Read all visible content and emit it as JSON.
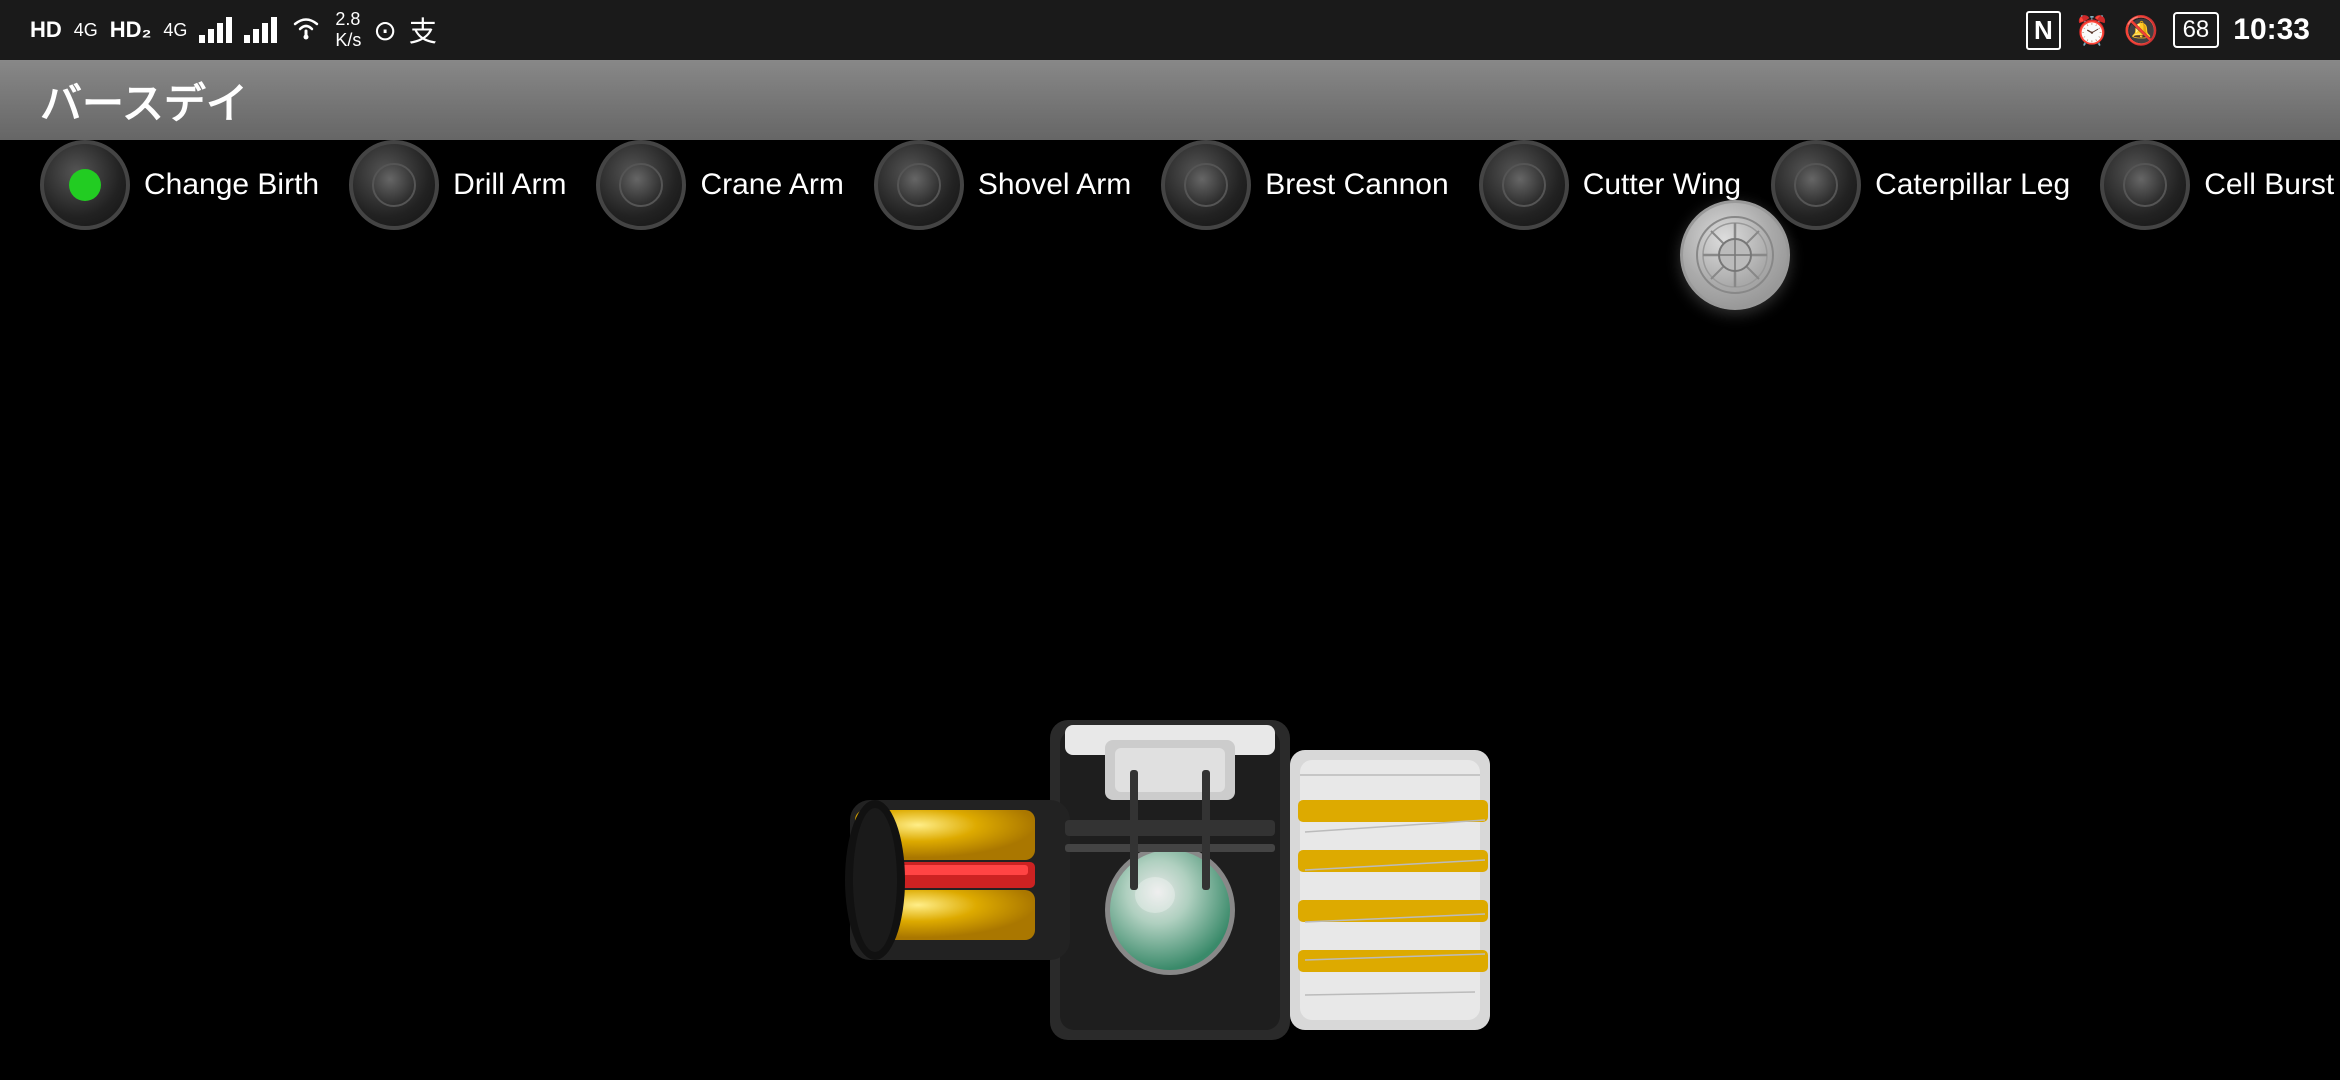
{
  "statusBar": {
    "leftItems": [
      "HD₁",
      "4G",
      "HD₂",
      "4G",
      "2.8 K/s"
    ],
    "rightItems": [
      "N",
      "⏰",
      "🔕",
      "68",
      "10:33"
    ]
  },
  "appTitle": "バースデイ",
  "buttons": [
    {
      "id": "change-birth",
      "label": "Change\nBirth",
      "active": true
    },
    {
      "id": "drill-arm",
      "label": "Drill\nArm",
      "active": false
    },
    {
      "id": "crane-arm",
      "label": "Crane\nArm",
      "active": false
    },
    {
      "id": "shovel-arm",
      "label": "Shovel\nArm",
      "active": false
    },
    {
      "id": "brest-cannon",
      "label": "Brest\nCannon",
      "active": false
    },
    {
      "id": "cutter-wing",
      "label": "Cutter\nWing",
      "active": false
    },
    {
      "id": "caterpillar-leg",
      "label": "Caterpillar\nLeg",
      "active": false
    },
    {
      "id": "cell-burst",
      "label": "Cell\nBurst",
      "active": false
    }
  ],
  "device": {
    "description": "Birth Driver device illustration"
  },
  "colors": {
    "activeDot": "#22cc22",
    "titleBarStart": "#888888",
    "titleBarEnd": "#666666",
    "statusBar": "#1a1a1a",
    "background": "#000000",
    "xCircle": "#aaaaaa"
  }
}
